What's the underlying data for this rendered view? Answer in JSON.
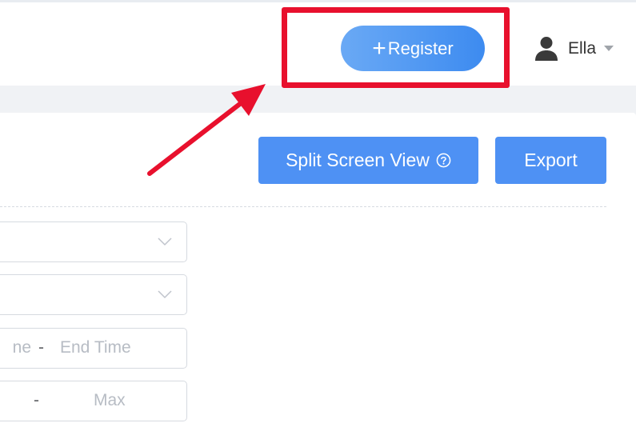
{
  "header": {
    "register_button": {
      "plus": "+",
      "label": "Register"
    },
    "user": {
      "name": "Ella",
      "icon": "user-icon",
      "caret_icon": "caret-down-icon"
    }
  },
  "toolbar": {
    "split_screen_label": "Split Screen View",
    "split_screen_icon": "question-circle-icon",
    "export_label": "Export"
  },
  "filters": {
    "select_1": {
      "value": "",
      "icon": "chevron-down-icon"
    },
    "select_2": {
      "value": "",
      "icon": "chevron-down-icon"
    },
    "time_range": {
      "start_placeholder_visible": "ne",
      "separator": "-",
      "end_placeholder": "End Time"
    },
    "number_range": {
      "min_placeholder": "",
      "separator": "-",
      "max_placeholder": "Max"
    }
  },
  "annotation": {
    "box_color": "#e8102d",
    "arrow_color": "#e8102d"
  },
  "colors": {
    "primary_button": "#4e91f4",
    "register_gradient_start": "#6aa9f5",
    "register_gradient_end": "#3d8bf0",
    "background": "#f0f2f5"
  }
}
